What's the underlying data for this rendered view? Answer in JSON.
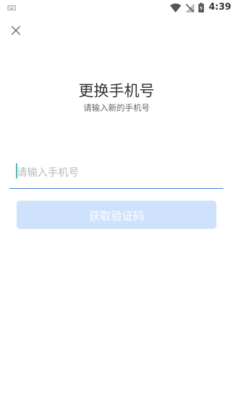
{
  "status_bar": {
    "time": "4:39",
    "icons": [
      "keyboard-icon",
      "wifi-icon",
      "no-signal-icon",
      "battery-charging-icon"
    ]
  },
  "header": {
    "close_icon": "close-icon",
    "title": "更换手机号",
    "subtitle": "请输入新的手机号"
  },
  "form": {
    "phone_value": "",
    "phone_placeholder": "请输入手机号",
    "get_code_label": "获取验证码",
    "get_code_enabled": false
  },
  "colors": {
    "accent": "#3a7bd5",
    "button_disabled": "#cfe2fb",
    "caret": "#4db6ac"
  }
}
